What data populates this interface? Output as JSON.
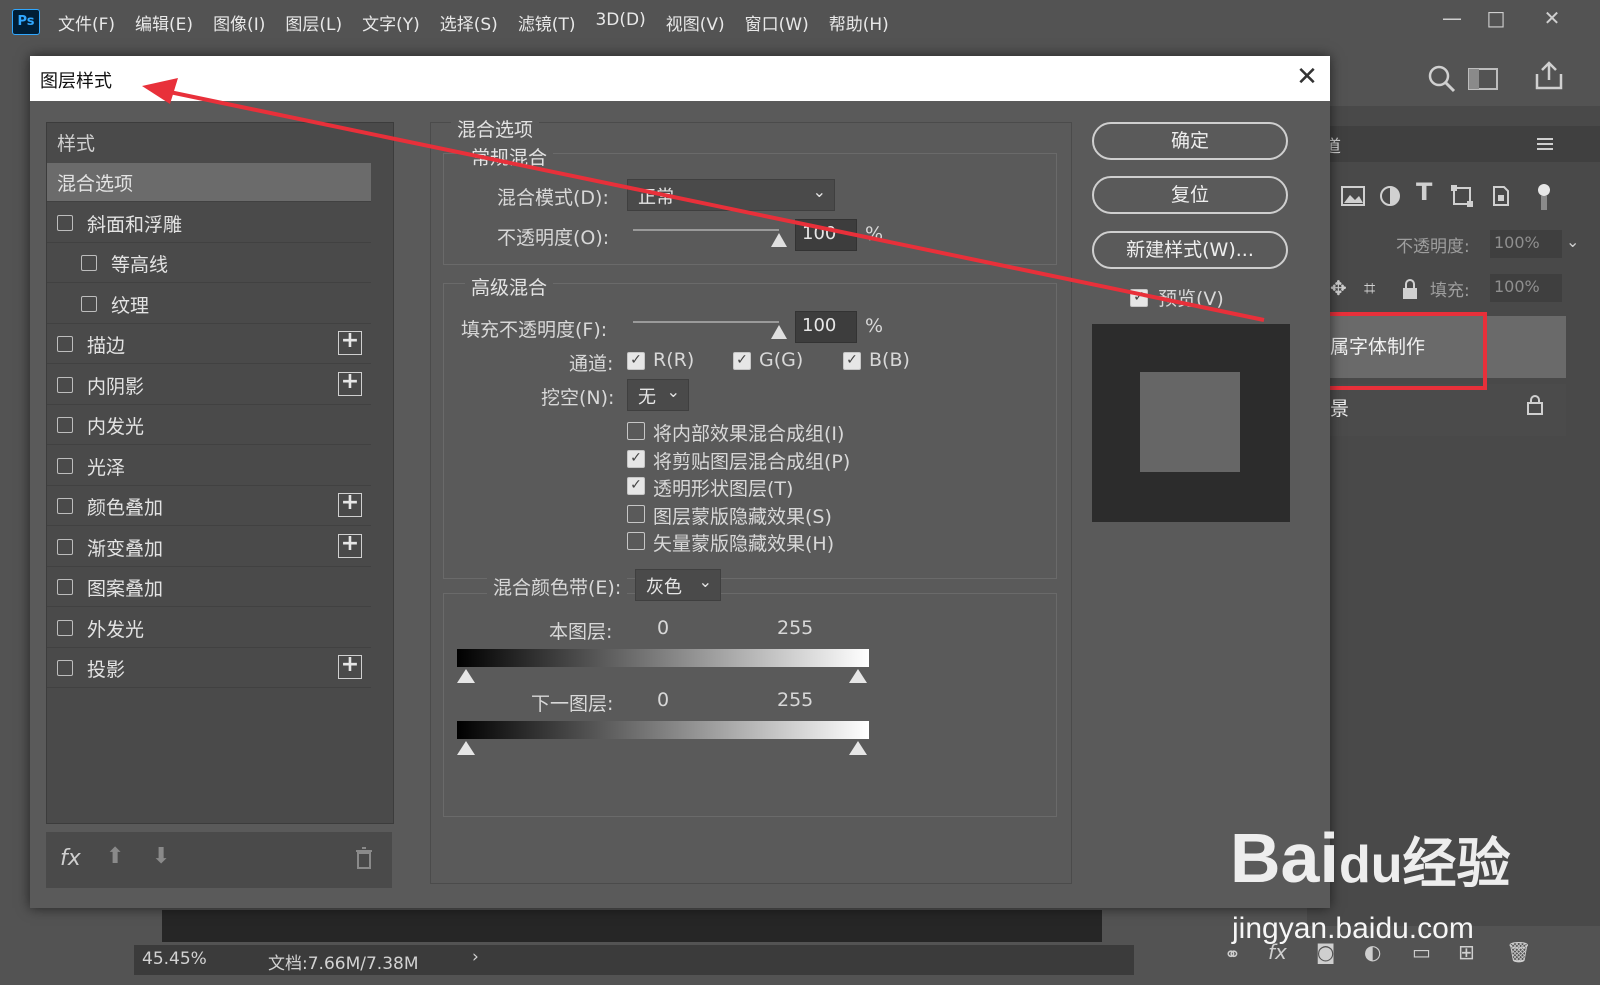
{
  "menubar": {
    "logo": "Ps",
    "items": [
      "文件(F)",
      "编辑(E)",
      "图像(I)",
      "图层(L)",
      "文字(Y)",
      "选择(S)",
      "滤镜(T)",
      "3D(D)",
      "视图(V)",
      "窗口(W)",
      "帮助(H)"
    ]
  },
  "window_controls": {
    "minimize": "—",
    "maximize": "□",
    "close": "✕"
  },
  "dialog": {
    "title": "图层样式",
    "close": "✕",
    "styles_header": "样式",
    "styles": [
      {
        "label": "混合选项",
        "checkbox": false,
        "selected": true,
        "plus": false
      },
      {
        "label": "斜面和浮雕",
        "checkbox": true,
        "plus": false
      },
      {
        "label": "等高线",
        "checkbox": true,
        "indent": true,
        "plus": false
      },
      {
        "label": "纹理",
        "checkbox": true,
        "indent": true,
        "plus": false
      },
      {
        "label": "描边",
        "checkbox": true,
        "plus": true
      },
      {
        "label": "内阴影",
        "checkbox": true,
        "plus": true
      },
      {
        "label": "内发光",
        "checkbox": true,
        "plus": false
      },
      {
        "label": "光泽",
        "checkbox": true,
        "plus": false
      },
      {
        "label": "颜色叠加",
        "checkbox": true,
        "plus": true
      },
      {
        "label": "渐变叠加",
        "checkbox": true,
        "plus": true
      },
      {
        "label": "图案叠加",
        "checkbox": true,
        "plus": false
      },
      {
        "label": "外发光",
        "checkbox": true,
        "plus": false
      },
      {
        "label": "投影",
        "checkbox": true,
        "plus": true
      }
    ],
    "bottom_fx": "fx",
    "blend_options": {
      "section_title": "混合选项",
      "general_title": "常规混合",
      "blend_mode_label": "混合模式(D):",
      "blend_mode_value": "正常",
      "opacity_label": "不透明度(O):",
      "opacity_value": "100",
      "percent": "%",
      "advanced_title": "高级混合",
      "fill_opacity_label": "填充不透明度(F):",
      "fill_opacity_value": "100",
      "channels_label": "通道:",
      "channels": [
        "R(R)",
        "G(G)",
        "B(B)"
      ],
      "knockout_label": "挖空(N):",
      "knockout_value": "无",
      "options": [
        {
          "label": "将内部效果混合成组(I)",
          "checked": false
        },
        {
          "label": "将剪贴图层混合成组(P)",
          "checked": true
        },
        {
          "label": "透明形状图层(T)",
          "checked": true
        },
        {
          "label": "图层蒙版隐藏效果(S)",
          "checked": false
        },
        {
          "label": "矢量蒙版隐藏效果(H)",
          "checked": false
        }
      ],
      "blend_if_label": "混合颜色带(E):",
      "blend_if_value": "灰色",
      "this_layer_label": "本图层:",
      "underlying_label": "下一图层:",
      "range_min": "0",
      "range_max": "255"
    },
    "buttons": {
      "ok": "确定",
      "reset": "复位",
      "new_style": "新建样式(W)..."
    },
    "preview_label": "预览(V)"
  },
  "right_panel": {
    "tab": "通道",
    "opacity_label": "不透明度:",
    "opacity_value": "100%",
    "fill_label": "填充:",
    "fill_value": "100%",
    "layers": [
      "属字体制作",
      "景"
    ]
  },
  "status": {
    "zoom": "45.45%",
    "doc": "文档:7.66M/7.38M",
    "arrow": "›"
  },
  "watermark": {
    "brand": "Bai",
    "du": "du",
    "cn": "经验",
    "url": "jingyan.baidu.com"
  },
  "colors": {
    "arrow": "#e8303a",
    "highlight": "#e8303a"
  }
}
